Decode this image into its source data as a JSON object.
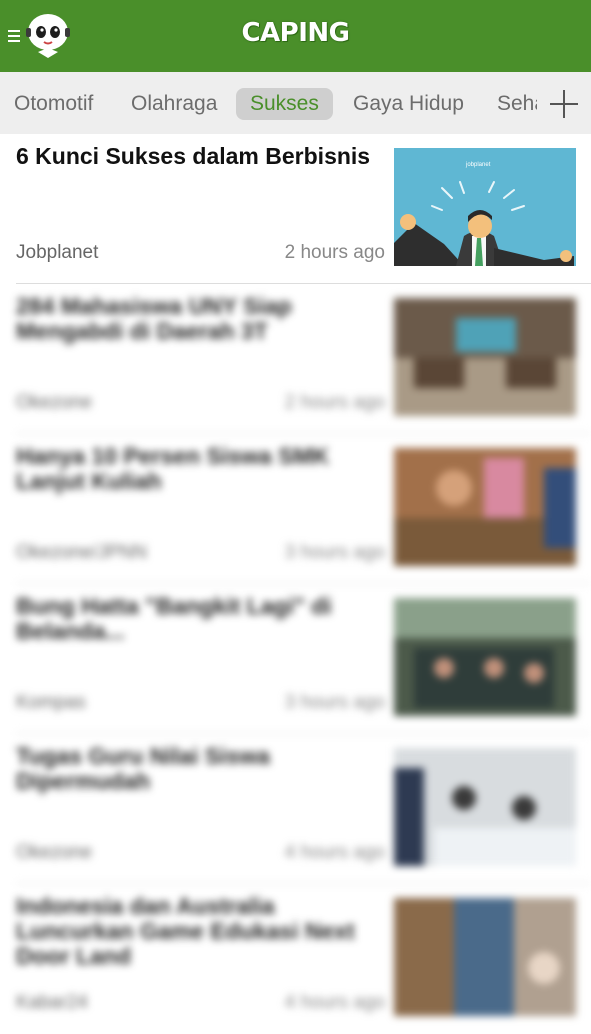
{
  "app": {
    "brand": "CAPING"
  },
  "tabs": [
    {
      "label": "Otomotif",
      "active": false
    },
    {
      "label": "Olahraga",
      "active": false
    },
    {
      "label": "Sukses",
      "active": true
    },
    {
      "label": "Gaya Hidup",
      "active": false
    },
    {
      "label": "Seha",
      "active": false
    }
  ],
  "articles": [
    {
      "title": "6 Kunci Sukses dalam Berbisnis",
      "source": "Jobplanet",
      "time": "2 hours ago",
      "thumb_text": "jobplanet"
    },
    {
      "title": "284 Mahasiswa UNY Siap Mengabdi di Daerah 3T",
      "source": "Okezone",
      "time": "2 hours ago"
    },
    {
      "title": "Hanya 10 Persen Siswa SMK Lanjut Kuliah",
      "source": "Okezone/JPNN",
      "time": "3 hours ago"
    },
    {
      "title": "Bung Hatta \"Bangkit Lagi\" di Belanda...",
      "source": "Kompas",
      "time": "3 hours ago"
    },
    {
      "title": "Tugas Guru Nilai Siswa Dipermudah",
      "source": "Okezone",
      "time": "4 hours ago"
    },
    {
      "title": "Indonesia dan Australia Luncurkan Game Edukasi Next Door Land",
      "source": "Kabar24",
      "time": "4 hours ago"
    }
  ],
  "colors": {
    "header": "#4a8f2a",
    "accent": "#4a8f2a",
    "tabbar": "#eeeeee"
  },
  "icons": {
    "menu": "hamburger-icon",
    "mascot": "mascot-logo",
    "add": "plus-icon"
  }
}
